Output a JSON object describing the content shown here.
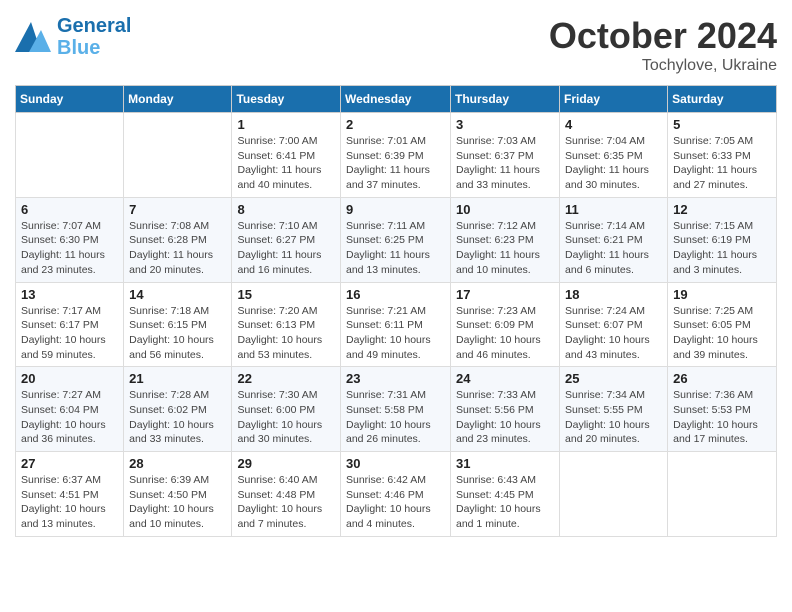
{
  "header": {
    "logo_line1": "General",
    "logo_line2": "Blue",
    "month": "October 2024",
    "location": "Tochylove, Ukraine"
  },
  "days_of_week": [
    "Sunday",
    "Monday",
    "Tuesday",
    "Wednesday",
    "Thursday",
    "Friday",
    "Saturday"
  ],
  "weeks": [
    [
      {
        "day": "",
        "info": ""
      },
      {
        "day": "",
        "info": ""
      },
      {
        "day": "1",
        "info": "Sunrise: 7:00 AM\nSunset: 6:41 PM\nDaylight: 11 hours and 40 minutes."
      },
      {
        "day": "2",
        "info": "Sunrise: 7:01 AM\nSunset: 6:39 PM\nDaylight: 11 hours and 37 minutes."
      },
      {
        "day": "3",
        "info": "Sunrise: 7:03 AM\nSunset: 6:37 PM\nDaylight: 11 hours and 33 minutes."
      },
      {
        "day": "4",
        "info": "Sunrise: 7:04 AM\nSunset: 6:35 PM\nDaylight: 11 hours and 30 minutes."
      },
      {
        "day": "5",
        "info": "Sunrise: 7:05 AM\nSunset: 6:33 PM\nDaylight: 11 hours and 27 minutes."
      }
    ],
    [
      {
        "day": "6",
        "info": "Sunrise: 7:07 AM\nSunset: 6:30 PM\nDaylight: 11 hours and 23 minutes."
      },
      {
        "day": "7",
        "info": "Sunrise: 7:08 AM\nSunset: 6:28 PM\nDaylight: 11 hours and 20 minutes."
      },
      {
        "day": "8",
        "info": "Sunrise: 7:10 AM\nSunset: 6:27 PM\nDaylight: 11 hours and 16 minutes."
      },
      {
        "day": "9",
        "info": "Sunrise: 7:11 AM\nSunset: 6:25 PM\nDaylight: 11 hours and 13 minutes."
      },
      {
        "day": "10",
        "info": "Sunrise: 7:12 AM\nSunset: 6:23 PM\nDaylight: 11 hours and 10 minutes."
      },
      {
        "day": "11",
        "info": "Sunrise: 7:14 AM\nSunset: 6:21 PM\nDaylight: 11 hours and 6 minutes."
      },
      {
        "day": "12",
        "info": "Sunrise: 7:15 AM\nSunset: 6:19 PM\nDaylight: 11 hours and 3 minutes."
      }
    ],
    [
      {
        "day": "13",
        "info": "Sunrise: 7:17 AM\nSunset: 6:17 PM\nDaylight: 10 hours and 59 minutes."
      },
      {
        "day": "14",
        "info": "Sunrise: 7:18 AM\nSunset: 6:15 PM\nDaylight: 10 hours and 56 minutes."
      },
      {
        "day": "15",
        "info": "Sunrise: 7:20 AM\nSunset: 6:13 PM\nDaylight: 10 hours and 53 minutes."
      },
      {
        "day": "16",
        "info": "Sunrise: 7:21 AM\nSunset: 6:11 PM\nDaylight: 10 hours and 49 minutes."
      },
      {
        "day": "17",
        "info": "Sunrise: 7:23 AM\nSunset: 6:09 PM\nDaylight: 10 hours and 46 minutes."
      },
      {
        "day": "18",
        "info": "Sunrise: 7:24 AM\nSunset: 6:07 PM\nDaylight: 10 hours and 43 minutes."
      },
      {
        "day": "19",
        "info": "Sunrise: 7:25 AM\nSunset: 6:05 PM\nDaylight: 10 hours and 39 minutes."
      }
    ],
    [
      {
        "day": "20",
        "info": "Sunrise: 7:27 AM\nSunset: 6:04 PM\nDaylight: 10 hours and 36 minutes."
      },
      {
        "day": "21",
        "info": "Sunrise: 7:28 AM\nSunset: 6:02 PM\nDaylight: 10 hours and 33 minutes."
      },
      {
        "day": "22",
        "info": "Sunrise: 7:30 AM\nSunset: 6:00 PM\nDaylight: 10 hours and 30 minutes."
      },
      {
        "day": "23",
        "info": "Sunrise: 7:31 AM\nSunset: 5:58 PM\nDaylight: 10 hours and 26 minutes."
      },
      {
        "day": "24",
        "info": "Sunrise: 7:33 AM\nSunset: 5:56 PM\nDaylight: 10 hours and 23 minutes."
      },
      {
        "day": "25",
        "info": "Sunrise: 7:34 AM\nSunset: 5:55 PM\nDaylight: 10 hours and 20 minutes."
      },
      {
        "day": "26",
        "info": "Sunrise: 7:36 AM\nSunset: 5:53 PM\nDaylight: 10 hours and 17 minutes."
      }
    ],
    [
      {
        "day": "27",
        "info": "Sunrise: 6:37 AM\nSunset: 4:51 PM\nDaylight: 10 hours and 13 minutes."
      },
      {
        "day": "28",
        "info": "Sunrise: 6:39 AM\nSunset: 4:50 PM\nDaylight: 10 hours and 10 minutes."
      },
      {
        "day": "29",
        "info": "Sunrise: 6:40 AM\nSunset: 4:48 PM\nDaylight: 10 hours and 7 minutes."
      },
      {
        "day": "30",
        "info": "Sunrise: 6:42 AM\nSunset: 4:46 PM\nDaylight: 10 hours and 4 minutes."
      },
      {
        "day": "31",
        "info": "Sunrise: 6:43 AM\nSunset: 4:45 PM\nDaylight: 10 hours and 1 minute."
      },
      {
        "day": "",
        "info": ""
      },
      {
        "day": "",
        "info": ""
      }
    ]
  ]
}
